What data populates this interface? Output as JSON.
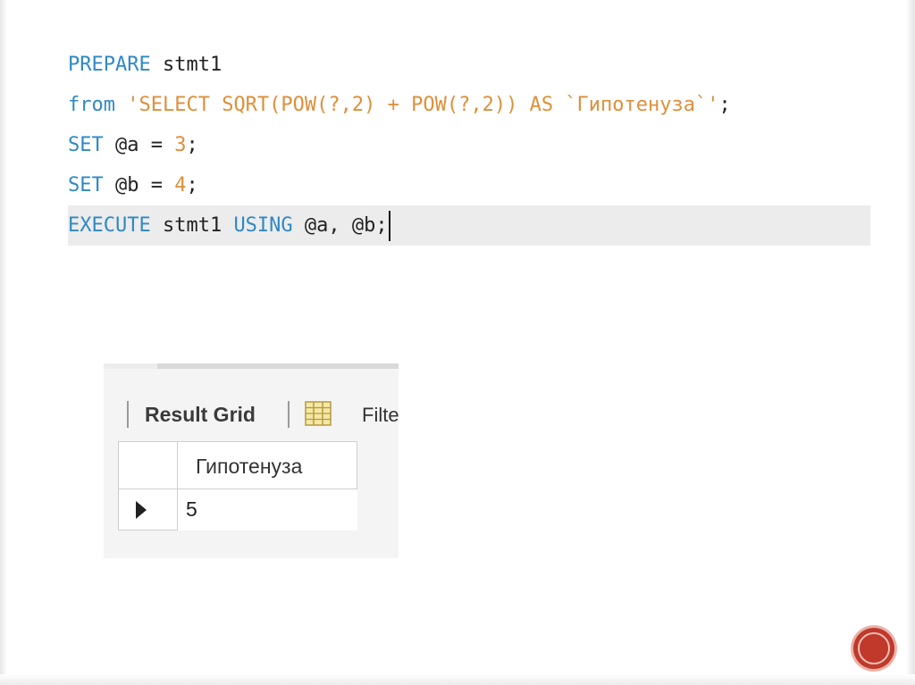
{
  "editor": {
    "lines": [
      {
        "tokens": [
          {
            "type": "kw",
            "text": "PREPARE"
          },
          {
            "type": "plain",
            "text": " stmt1"
          }
        ]
      },
      {
        "tokens": [
          {
            "type": "kw",
            "text": "from"
          },
          {
            "type": "plain",
            "text": " "
          },
          {
            "type": "str",
            "text": "'SELECT SQRT(POW(?,2) + POW(?,2)) AS `Гипотенуза`'"
          },
          {
            "type": "plain",
            "text": ";"
          }
        ]
      },
      {
        "tokens": [
          {
            "type": "kw",
            "text": "SET"
          },
          {
            "type": "plain",
            "text": " @a = "
          },
          {
            "type": "num",
            "text": "3"
          },
          {
            "type": "plain",
            "text": ";"
          }
        ]
      },
      {
        "tokens": [
          {
            "type": "kw",
            "text": "SET"
          },
          {
            "type": "plain",
            "text": " @b = "
          },
          {
            "type": "num",
            "text": "4"
          },
          {
            "type": "plain",
            "text": ";"
          }
        ]
      },
      {
        "active": true,
        "tokens": [
          {
            "type": "kw",
            "text": "EXECUTE"
          },
          {
            "type": "plain",
            "text": " stmt1 "
          },
          {
            "type": "kw",
            "text": "USING"
          },
          {
            "type": "plain",
            "text": " @a, @b;"
          }
        ]
      }
    ]
  },
  "result_panel": {
    "toolbar": {
      "result_grid_label": "Result Grid",
      "grid_icon": "grid-layout-icon",
      "filter_label": "Filte"
    },
    "grid": {
      "column_header": "Гипотенуза",
      "row_indicator_icon": "row-pointer-icon",
      "rows": [
        {
          "value": "5"
        }
      ]
    }
  },
  "slide": {
    "nav_icon": "slide-nav-button-icon"
  },
  "colors": {
    "keyword": "#2f89c4",
    "literal": "#de8f3a",
    "active_line": "#ececec",
    "nav_button": "#c0392b"
  }
}
